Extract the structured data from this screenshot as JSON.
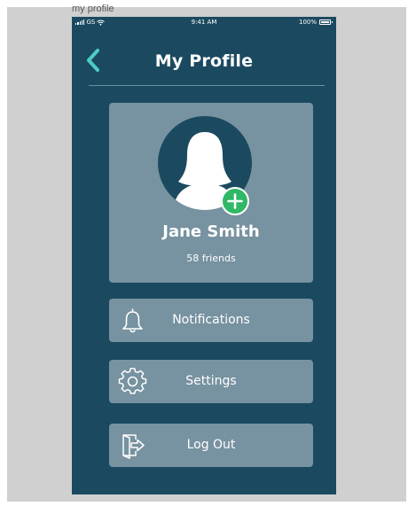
{
  "artboard": {
    "label": "my profile"
  },
  "status_bar": {
    "carrier": "GS",
    "time": "9:41 AM",
    "battery_text": "100%",
    "battery_level": 1.0
  },
  "nav": {
    "title": "My Profile",
    "back_icon": "chevron-left-icon"
  },
  "profile": {
    "name": "Jane Smith",
    "friends": "58 friends",
    "avatar_icon": "female-silhouette-icon",
    "add_photo_icon": "plus-circle-icon"
  },
  "menu": {
    "items": [
      {
        "label": "Notifications",
        "icon": "bell-icon"
      },
      {
        "label": "Settings",
        "icon": "gear-icon"
      },
      {
        "label": "Log Out",
        "icon": "logout-door-icon"
      }
    ]
  },
  "colors": {
    "background": "#1b4a60",
    "card": "#7792a0",
    "accent": "#4ecdc4",
    "add_button": "#2fb866",
    "text": "#ffffff"
  }
}
